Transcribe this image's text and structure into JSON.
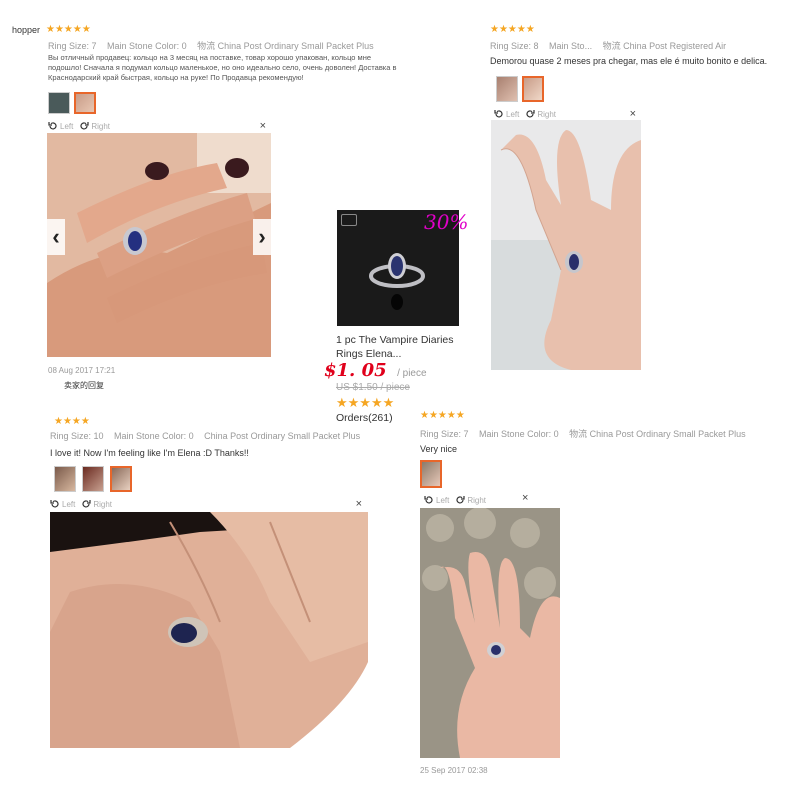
{
  "reviews": [
    {
      "user": "hopper",
      "stars": "★★★★★",
      "ring_size": "Ring Size: 7",
      "stone_color": "Main Stone Color: 0",
      "shipping": "物流 China Post Ordinary Small Packet Plus",
      "comment": "Вы отличный продавец: кольцо на 3 месяц на поставке, товар хорошо упакован, кольцо мне подошло! Сначала я подумал кольцо маленькое, но оно идеально село, очень доволен! Доставка в Краснодарский край быстрая, кольцо на руке! По Продавца рекомендую!",
      "nav_prev": "‹",
      "nav_next": "›",
      "date": "08 Aug 2017 17:21",
      "seller_reply": "卖家的回复"
    },
    {
      "stars": "★★★★★",
      "ring_size": "Ring Size: 8",
      "stone_color": "Main Sto...",
      "shipping": "物流 China Post Registered Air",
      "comment": "Demorou quase 2 meses pra chegar, mas ele é muito bonito e delica."
    },
    {
      "stars": "★★★★",
      "ring_size": "Ring Size: 10",
      "stone_color": "Main Stone Color: 0",
      "shipping": "China Post Ordinary Small Packet Plus",
      "comment": "I love it! Now I'm feeling like I'm Elena :D Thanks!!"
    },
    {
      "stars": "★★★★★",
      "ring_size": "Ring Size: 7",
      "stone_color": "Main Stone Color: 0",
      "shipping": "物流 China Post Ordinary Small Packet Plus",
      "comment": "Very nice",
      "date": "25 Sep 2017 02:38"
    }
  ],
  "viewer": {
    "rotate_left": "Left",
    "rotate_right": "Right",
    "close": "×"
  },
  "product": {
    "discount": "30%",
    "title_line1": "1 pc The Vampire Diaries",
    "title_line2": "Rings Elena...",
    "price": "$1. 05",
    "price_unit": "/ piece",
    "original_price": "US $1.50 / piece",
    "stars": "★★★★★",
    "orders": "Orders(261)"
  },
  "colors": {
    "star": "#f5a623",
    "price": "#e0001b",
    "discount": "#e000c8",
    "accent": "#e8662a"
  }
}
